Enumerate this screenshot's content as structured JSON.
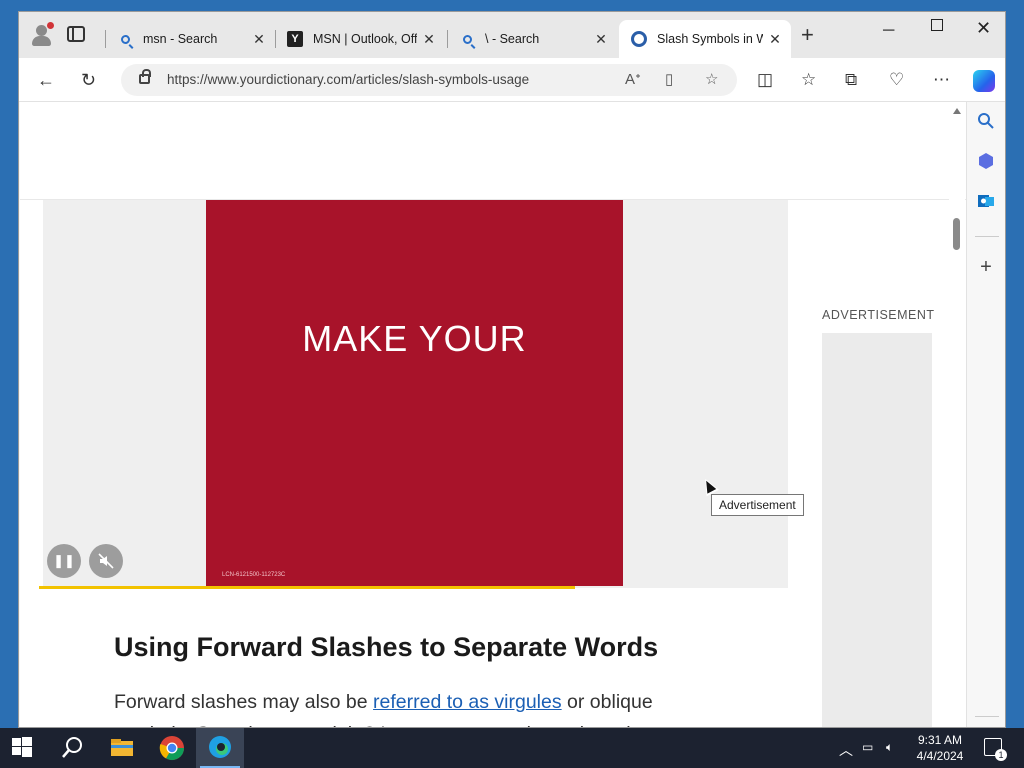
{
  "tabs": [
    {
      "label": "msn - Search",
      "icon": "search-icon"
    },
    {
      "label": "MSN | Outlook, Offi",
      "icon": "msn-logo-icon"
    },
    {
      "label": "\\ - Search",
      "icon": "search-icon"
    },
    {
      "label": "Slash Symbols in Wo",
      "icon": "yourdictionary-icon",
      "active": true
    }
  ],
  "address_bar": {
    "url": "https://www.yourdictionary.com/articles/slash-symbols-usage"
  },
  "video_ad": {
    "headline": "MAKE YOUR",
    "code": "LCN-6121500-112723C",
    "progress_fraction": 0.72
  },
  "ad_sidebar": {
    "label": "ADVERTISEMENT"
  },
  "tooltip": {
    "text": "Advertisement"
  },
  "article": {
    "heading": "Using Forward Slashes to Separate Words",
    "para_before": "Forward slashes may also be ",
    "para_link": "referred to as virgules",
    "para_after": " or oblique symbols. Sounds pretty, right? It seems appropriate, given that"
  },
  "clock": {
    "time": "9:31 AM",
    "date": "4/4/2024"
  },
  "notification_count": "1",
  "colors": {
    "ad_red": "#a8132a",
    "progress": "#f2c200",
    "link": "#1b5fb4"
  }
}
